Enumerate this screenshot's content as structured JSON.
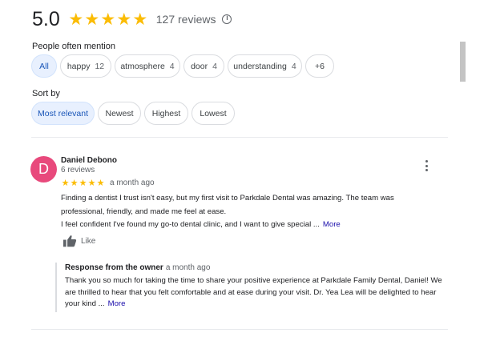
{
  "header": {
    "rating_value": "5.0",
    "stars": [
      "★",
      "★",
      "★",
      "★",
      "★"
    ],
    "review_count": "127 reviews",
    "star_color": "#fbbc04"
  },
  "mentions": {
    "label": "People often mention",
    "chips": [
      {
        "label": "All",
        "count": "",
        "selected": true
      },
      {
        "label": "happy",
        "count": "12",
        "selected": false
      },
      {
        "label": "atmosphere",
        "count": "4",
        "selected": false
      },
      {
        "label": "door",
        "count": "4",
        "selected": false
      },
      {
        "label": "understanding",
        "count": "4",
        "selected": false
      },
      {
        "label": "+6",
        "count": "",
        "selected": false
      }
    ]
  },
  "sort": {
    "label": "Sort by",
    "options": [
      {
        "label": "Most relevant",
        "selected": true
      },
      {
        "label": "Newest",
        "selected": false
      },
      {
        "label": "Highest",
        "selected": false
      },
      {
        "label": "Lowest",
        "selected": false
      }
    ]
  },
  "review": {
    "avatar_letter": "D",
    "avatar_color": "#e8497c",
    "name": "Daniel Debono",
    "meta": "6 reviews",
    "rating": 5,
    "date": "a month ago",
    "text_line1": "Finding a dentist I trust isn't easy, but my first visit to Parkdale Dental was amazing. The team was",
    "text_line2": "professional, friendly, and made me feel at ease.",
    "text_line3": "I feel confident I've found my go-to dental clinic, and I want to give special ...",
    "more_label": "More",
    "like_label": "Like",
    "owner_response": {
      "title": "Response from the owner",
      "date": "a month ago",
      "text": "Thank you so much for taking the time to share your positive experience at Parkdale Family Dental, Daniel! We are thrilled to hear that you felt comfortable and at ease during your visit. Dr. Yea Lea will be delighted to hear your kind ...",
      "more_label": "More"
    }
  }
}
